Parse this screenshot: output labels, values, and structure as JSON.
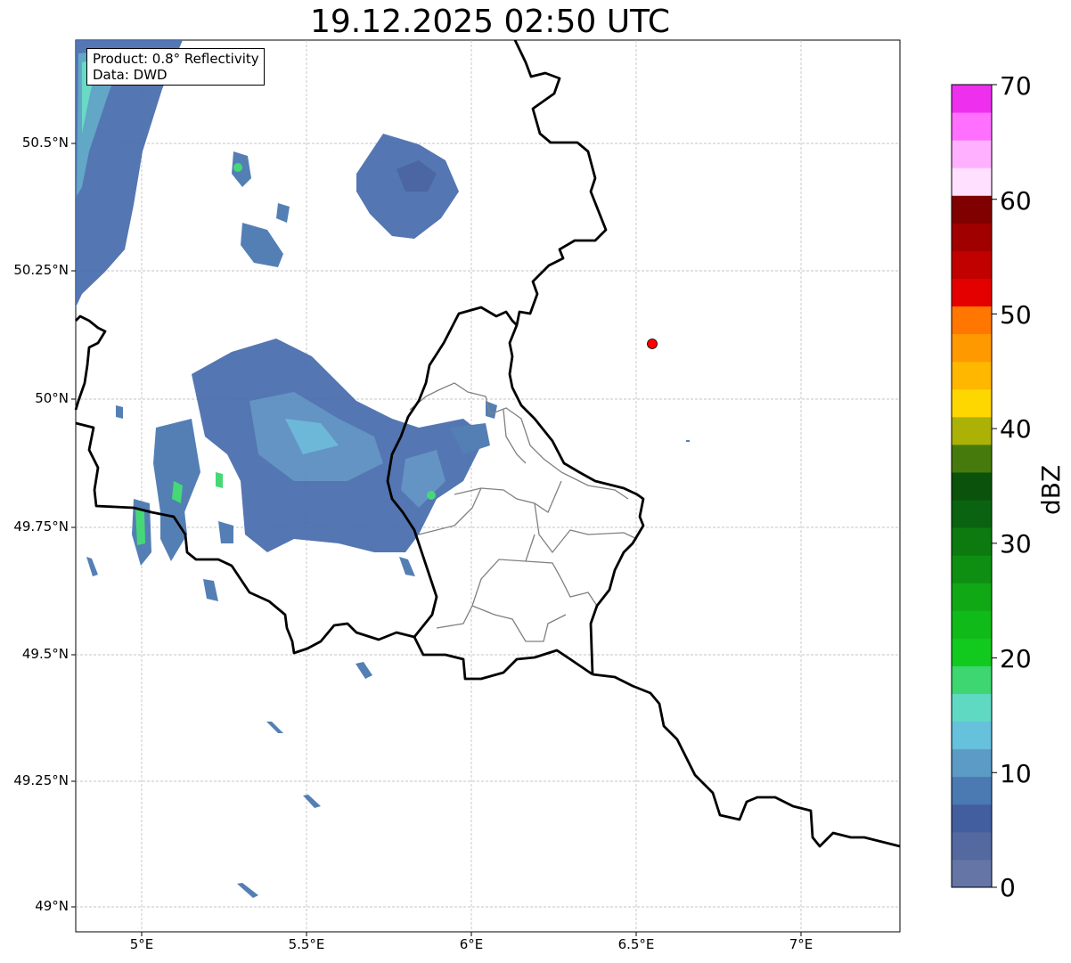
{
  "title": "19.12.2025 02:50 UTC",
  "info": {
    "product": "Product: 0.8° Reflectivity",
    "data": "Data: DWD"
  },
  "map": {
    "lat_ticks": [
      "50.5°N",
      "50.25°N",
      "50°N",
      "49.75°N",
      "49.5°N",
      "49.25°N",
      "49°N"
    ],
    "lon_ticks": [
      "5°E",
      "5.5°E",
      "6°E",
      "6.5°E",
      "7°E"
    ],
    "lon_range": [
      4.8,
      7.3
    ],
    "lat_range": [
      48.95,
      50.7
    ],
    "gridlines": true,
    "marker": {
      "lon": 6.55,
      "lat": 50.11,
      "color": "#ff0000"
    }
  },
  "colorbar": {
    "label": "dBZ",
    "ticks": [
      "70",
      "60",
      "50",
      "40",
      "30",
      "20",
      "10",
      "0"
    ],
    "colors": [
      "#6475a6",
      "#53699f",
      "#425e9f",
      "#4b79b1",
      "#5b9bc5",
      "#66c1dc",
      "#60d9c2",
      "#3dd670",
      "#12c91e",
      "#10ba18",
      "#10a815",
      "#0e8f12",
      "#0d7a10",
      "#0a6310",
      "#0b520c",
      "#477a0d",
      "#acb105",
      "#ffd700",
      "#ffb700",
      "#ff9900",
      "#ff7700",
      "#e50000",
      "#c10000",
      "#a10000",
      "#800000",
      "#ffe0ff",
      "#ffb0ff",
      "#ff70ff",
      "#ee30ee"
    ]
  }
}
